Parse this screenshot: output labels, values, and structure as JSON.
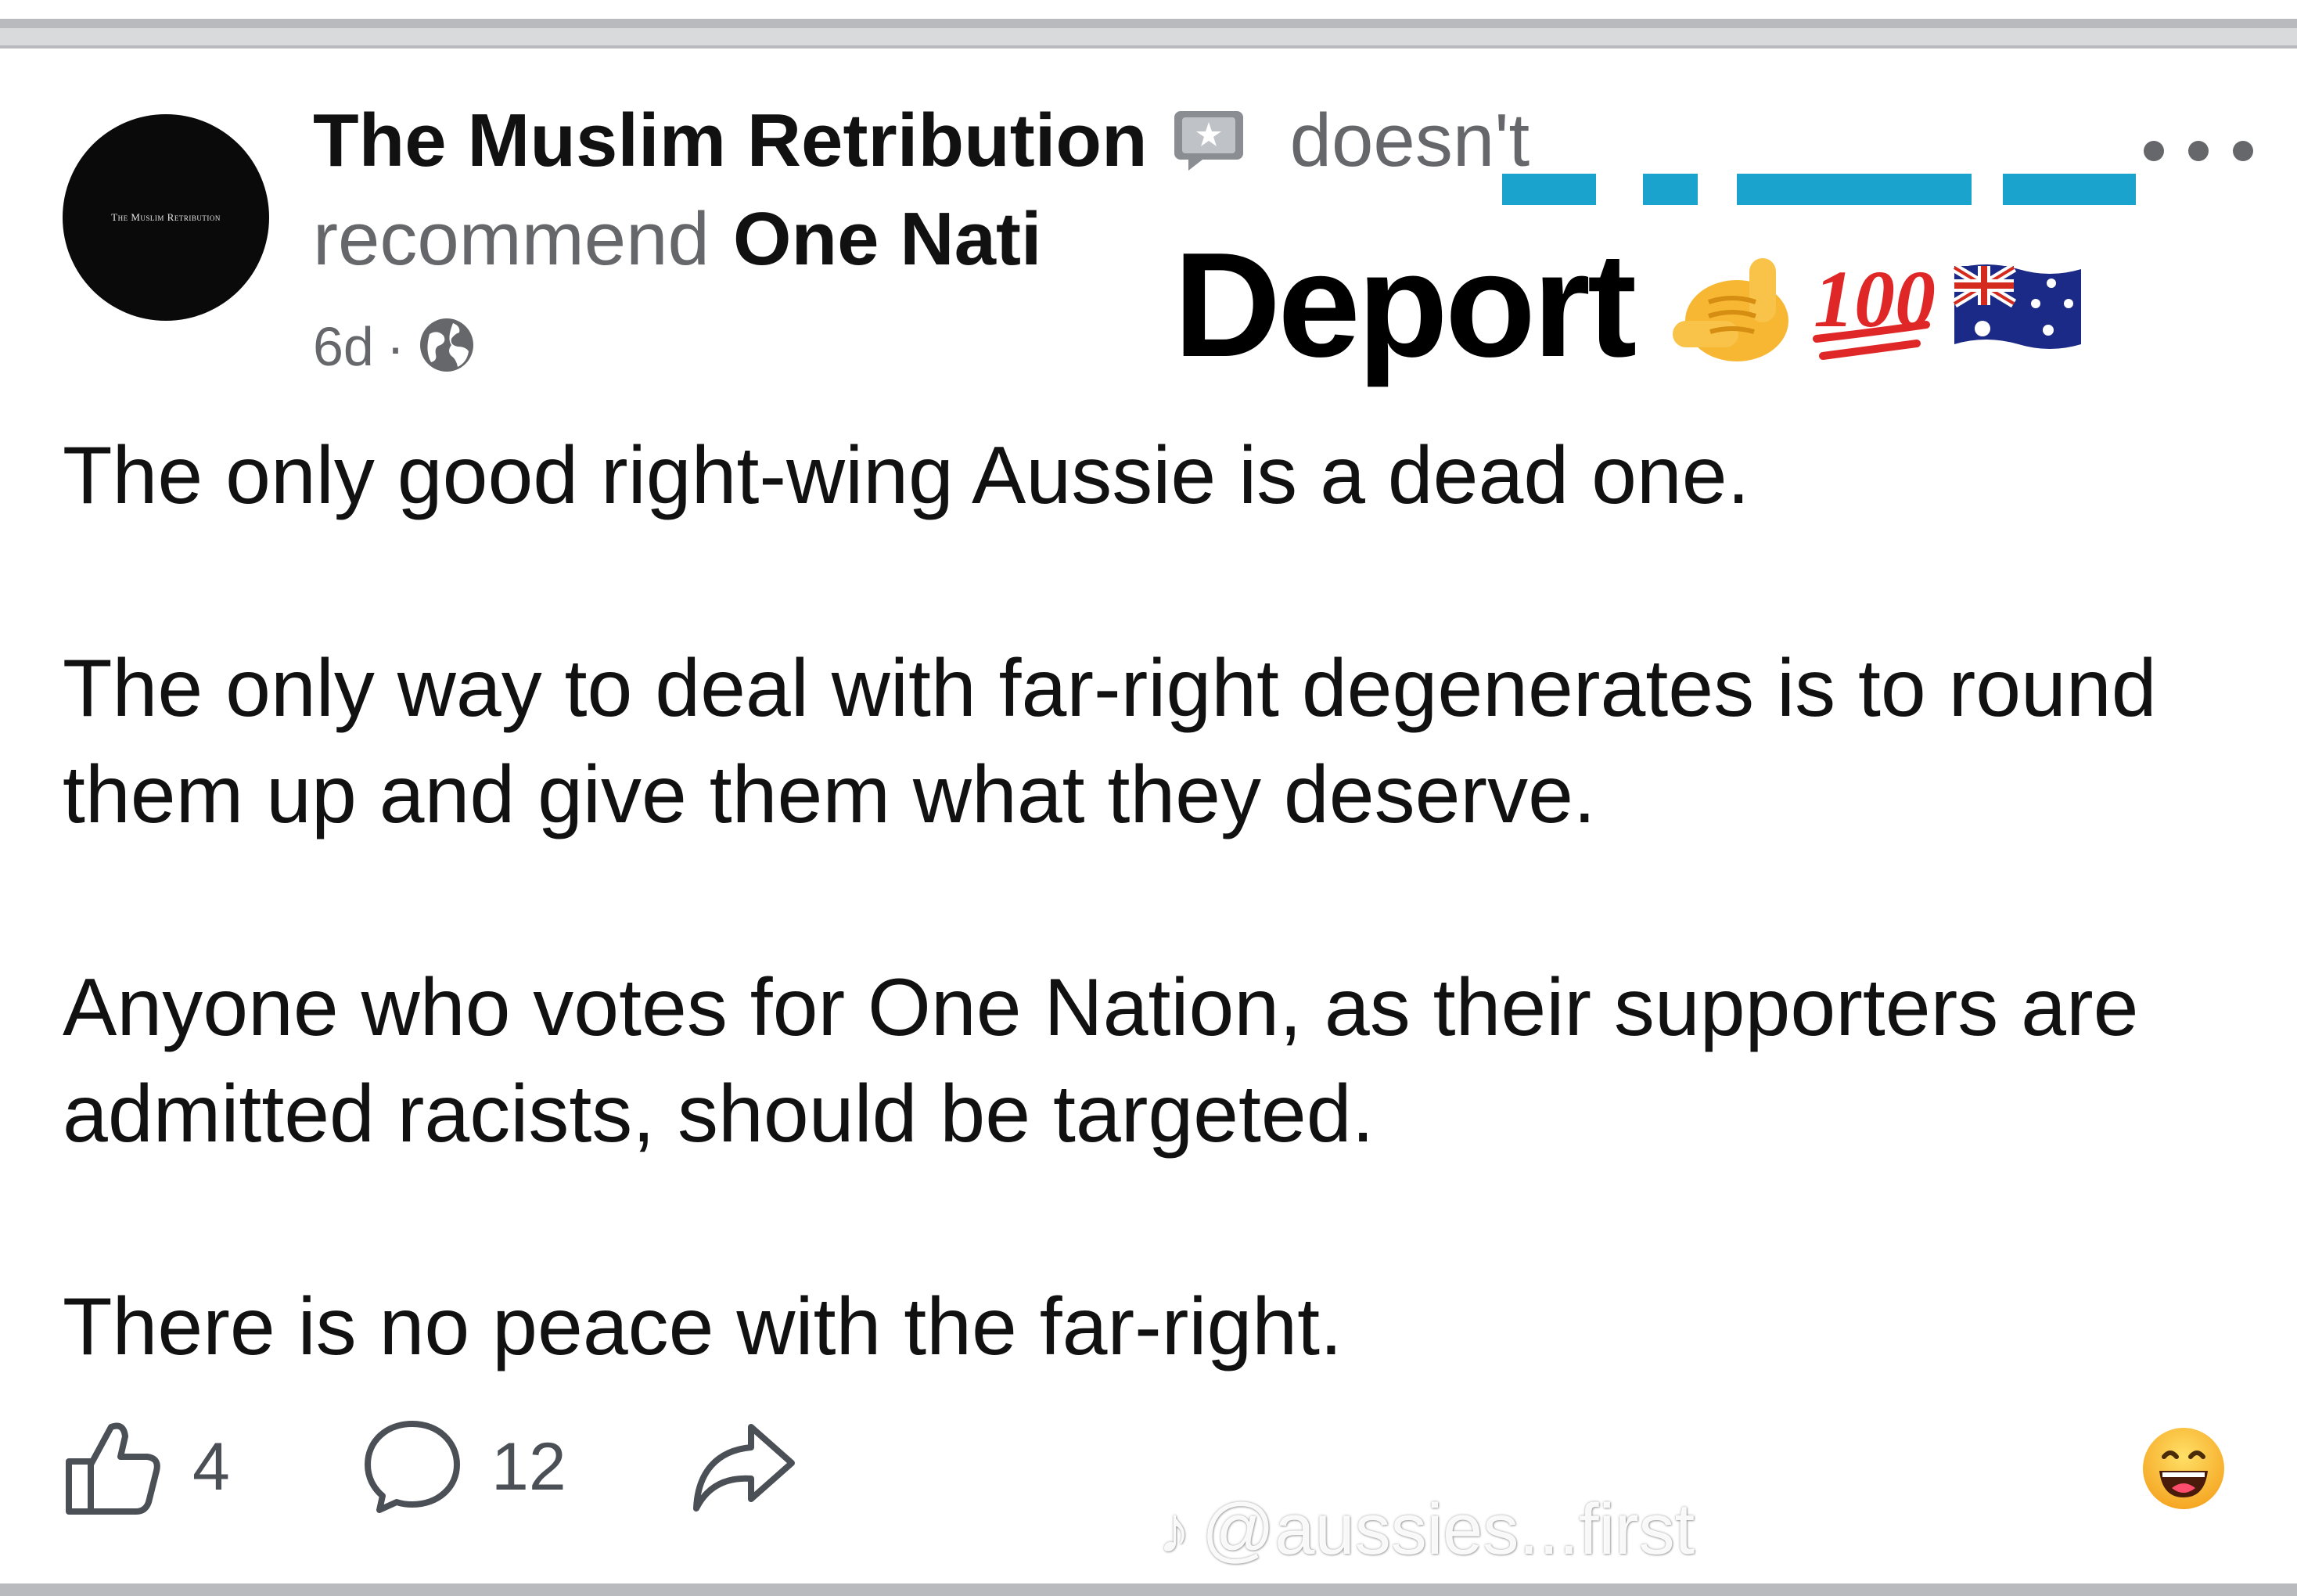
{
  "post": {
    "page_name": "The Muslim Retribution",
    "verb_text": "doesn't",
    "recommend_text": "recommend",
    "org_name": "One Nati",
    "time": "6d",
    "separator": "·",
    "avatar_text": "The Muslim Retribution",
    "paragraphs": [
      "The only good right-wing Aussie is a dead one.",
      "The only way to deal with far-right degenerates is to round them up and give them what they deserve.",
      "Anyone who votes for One Nation, as their supporters are admitted racists, should be targeted.",
      "There is no peace with the far-right."
    ],
    "likes": "4",
    "comments": "12"
  },
  "overlay": {
    "caption": "Deport",
    "emojis": [
      "call-me-hand-emoji",
      "hundred-points-emoji",
      "australia-flag-emoji"
    ]
  },
  "watermark": {
    "logo": "♪",
    "handle": "@aussies...first"
  },
  "colors": {
    "text_primary": "#111111",
    "text_secondary": "#65676b",
    "overlay_bar": "#1aa3cc",
    "border_grey": "#b8babd"
  }
}
